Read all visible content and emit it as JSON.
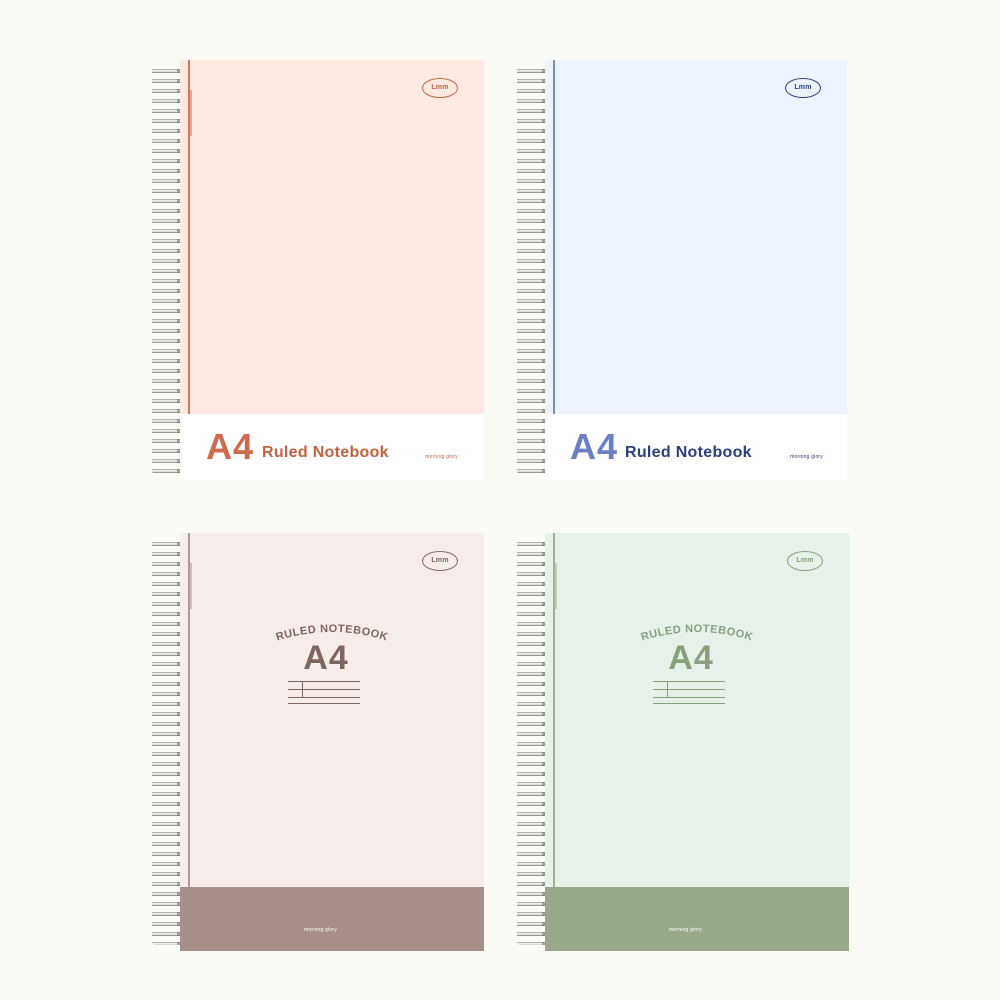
{
  "notebooks": [
    {
      "style": "band-bottom-light",
      "cover_color": "#fde9e1",
      "accent_color": "#d06a4d",
      "title_color": "#c4613f",
      "logo_text": "Lmm",
      "a4_text": "A4",
      "title_text": "Ruled Notebook",
      "brand_text": "morning glory"
    },
    {
      "style": "band-bottom-light",
      "cover_color": "#eef4fd",
      "accent_color": "#6b7fc3",
      "title_color": "#2d3f7a",
      "logo_text": "Lmm",
      "a4_text": "A4",
      "title_text": "Ruled Notebook",
      "brand_text": "morning glory"
    },
    {
      "style": "center-title",
      "cover_color": "#f6ecea",
      "accent_color": "#a78f8a",
      "title_color": "#7e6660",
      "logo_text": "Lmm",
      "arc_text": "RULED NOTEBOOK",
      "a4_text": "A4",
      "brand_text": "morning glory"
    },
    {
      "style": "center-title",
      "cover_color": "#e6f1ea",
      "accent_color": "#97a989",
      "title_color": "#88a07b",
      "logo_text": "Lmm",
      "arc_text": "RULED NOTEBOOK",
      "a4_text": "A4",
      "brand_text": "morning glory"
    }
  ]
}
